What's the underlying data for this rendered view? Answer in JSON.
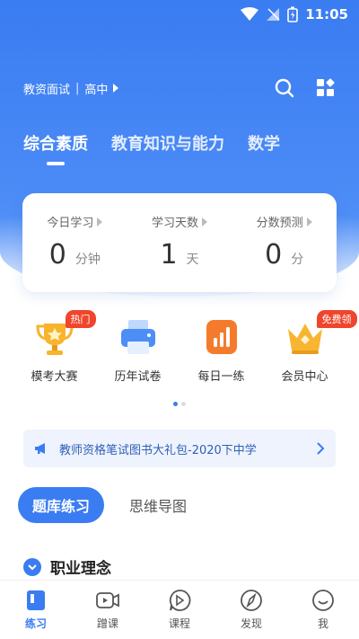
{
  "status": {
    "time": "11:05"
  },
  "header": {
    "exam": "教资面试",
    "level": "高中",
    "icons": [
      "search-icon",
      "apps-grid-icon"
    ]
  },
  "subjects": [
    {
      "label": "综合素质",
      "active": true
    },
    {
      "label": "教育知识与能力",
      "active": false
    },
    {
      "label": "数学",
      "active": false
    }
  ],
  "stats": [
    {
      "label": "今日学习",
      "value": "0",
      "unit": "分钟"
    },
    {
      "label": "学习天数",
      "value": "1",
      "unit": "天"
    },
    {
      "label": "分数预测",
      "value": "0",
      "unit": "分"
    }
  ],
  "quick": [
    {
      "label": "模考大赛",
      "badge": "热门",
      "icon": "trophy-icon"
    },
    {
      "label": "历年试卷",
      "badge": "",
      "icon": "printer-icon"
    },
    {
      "label": "每日一练",
      "badge": "",
      "icon": "bar-chart-icon"
    },
    {
      "label": "会员中心",
      "badge": "免费领",
      "icon": "crown-icon"
    }
  ],
  "notice": {
    "text": "教师资格笔试图书大礼包-2020下中学",
    "icon": "megaphone-icon"
  },
  "practice_tabs": [
    {
      "label": "题库练习",
      "active": true
    },
    {
      "label": "思维导图",
      "active": false
    }
  ],
  "section": {
    "title": "职业理念"
  },
  "nav": [
    {
      "label": "练习",
      "icon": "book-icon",
      "active": true
    },
    {
      "label": "蹭课",
      "icon": "video-icon",
      "active": false
    },
    {
      "label": "课程",
      "icon": "play-bubble-icon",
      "active": false
    },
    {
      "label": "发现",
      "icon": "compass-icon",
      "active": false
    },
    {
      "label": "我",
      "icon": "smile-icon",
      "active": false
    }
  ],
  "colors": {
    "primary": "#3a7cf2",
    "badge": "#f0452c",
    "notice_bg": "#eef3fd"
  }
}
